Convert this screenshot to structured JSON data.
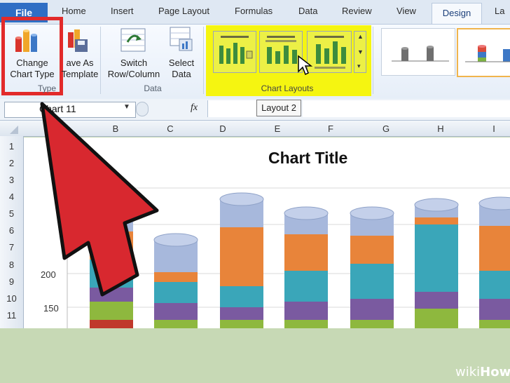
{
  "ribbon": {
    "tabs": [
      "File",
      "Home",
      "Insert",
      "Page Layout",
      "Formulas",
      "Data",
      "Review",
      "View",
      "Design",
      "La"
    ],
    "active_tab": "Design",
    "buttons": {
      "change_chart_type": [
        "Change",
        "Chart Type"
      ],
      "save_as_template": [
        "ave As",
        "Template"
      ],
      "switch_row_column": [
        "Switch",
        "Row/Column"
      ],
      "select_data": [
        "Select",
        "Data"
      ]
    },
    "groups": {
      "type": "Type",
      "data": "Data",
      "chart_layouts": "Chart Layouts"
    },
    "tooltip": "Layout 2"
  },
  "formula_bar": {
    "name_box": "Chart 11",
    "fx": "fx"
  },
  "columns": [
    "B",
    "C",
    "D",
    "E",
    "F",
    "G",
    "H",
    "I"
  ],
  "rows": [
    "1",
    "2",
    "3",
    "4",
    "5",
    "6",
    "7",
    "8",
    "9",
    "10",
    "11"
  ],
  "chart": {
    "title": "Chart Title",
    "y_ticks": [
      "200",
      "150"
    ]
  },
  "watermark": {
    "wiki": "wiki",
    "how": "How"
  },
  "colors": {
    "highlight_red": "#e22a2a",
    "highlight_yellow": "#f5f511",
    "arrow_red": "#d8282f",
    "series": [
      "#a7b8dc",
      "#e8843a",
      "#3aa6b9",
      "#7a5aa0",
      "#8eb83e",
      "#c0392b"
    ]
  }
}
